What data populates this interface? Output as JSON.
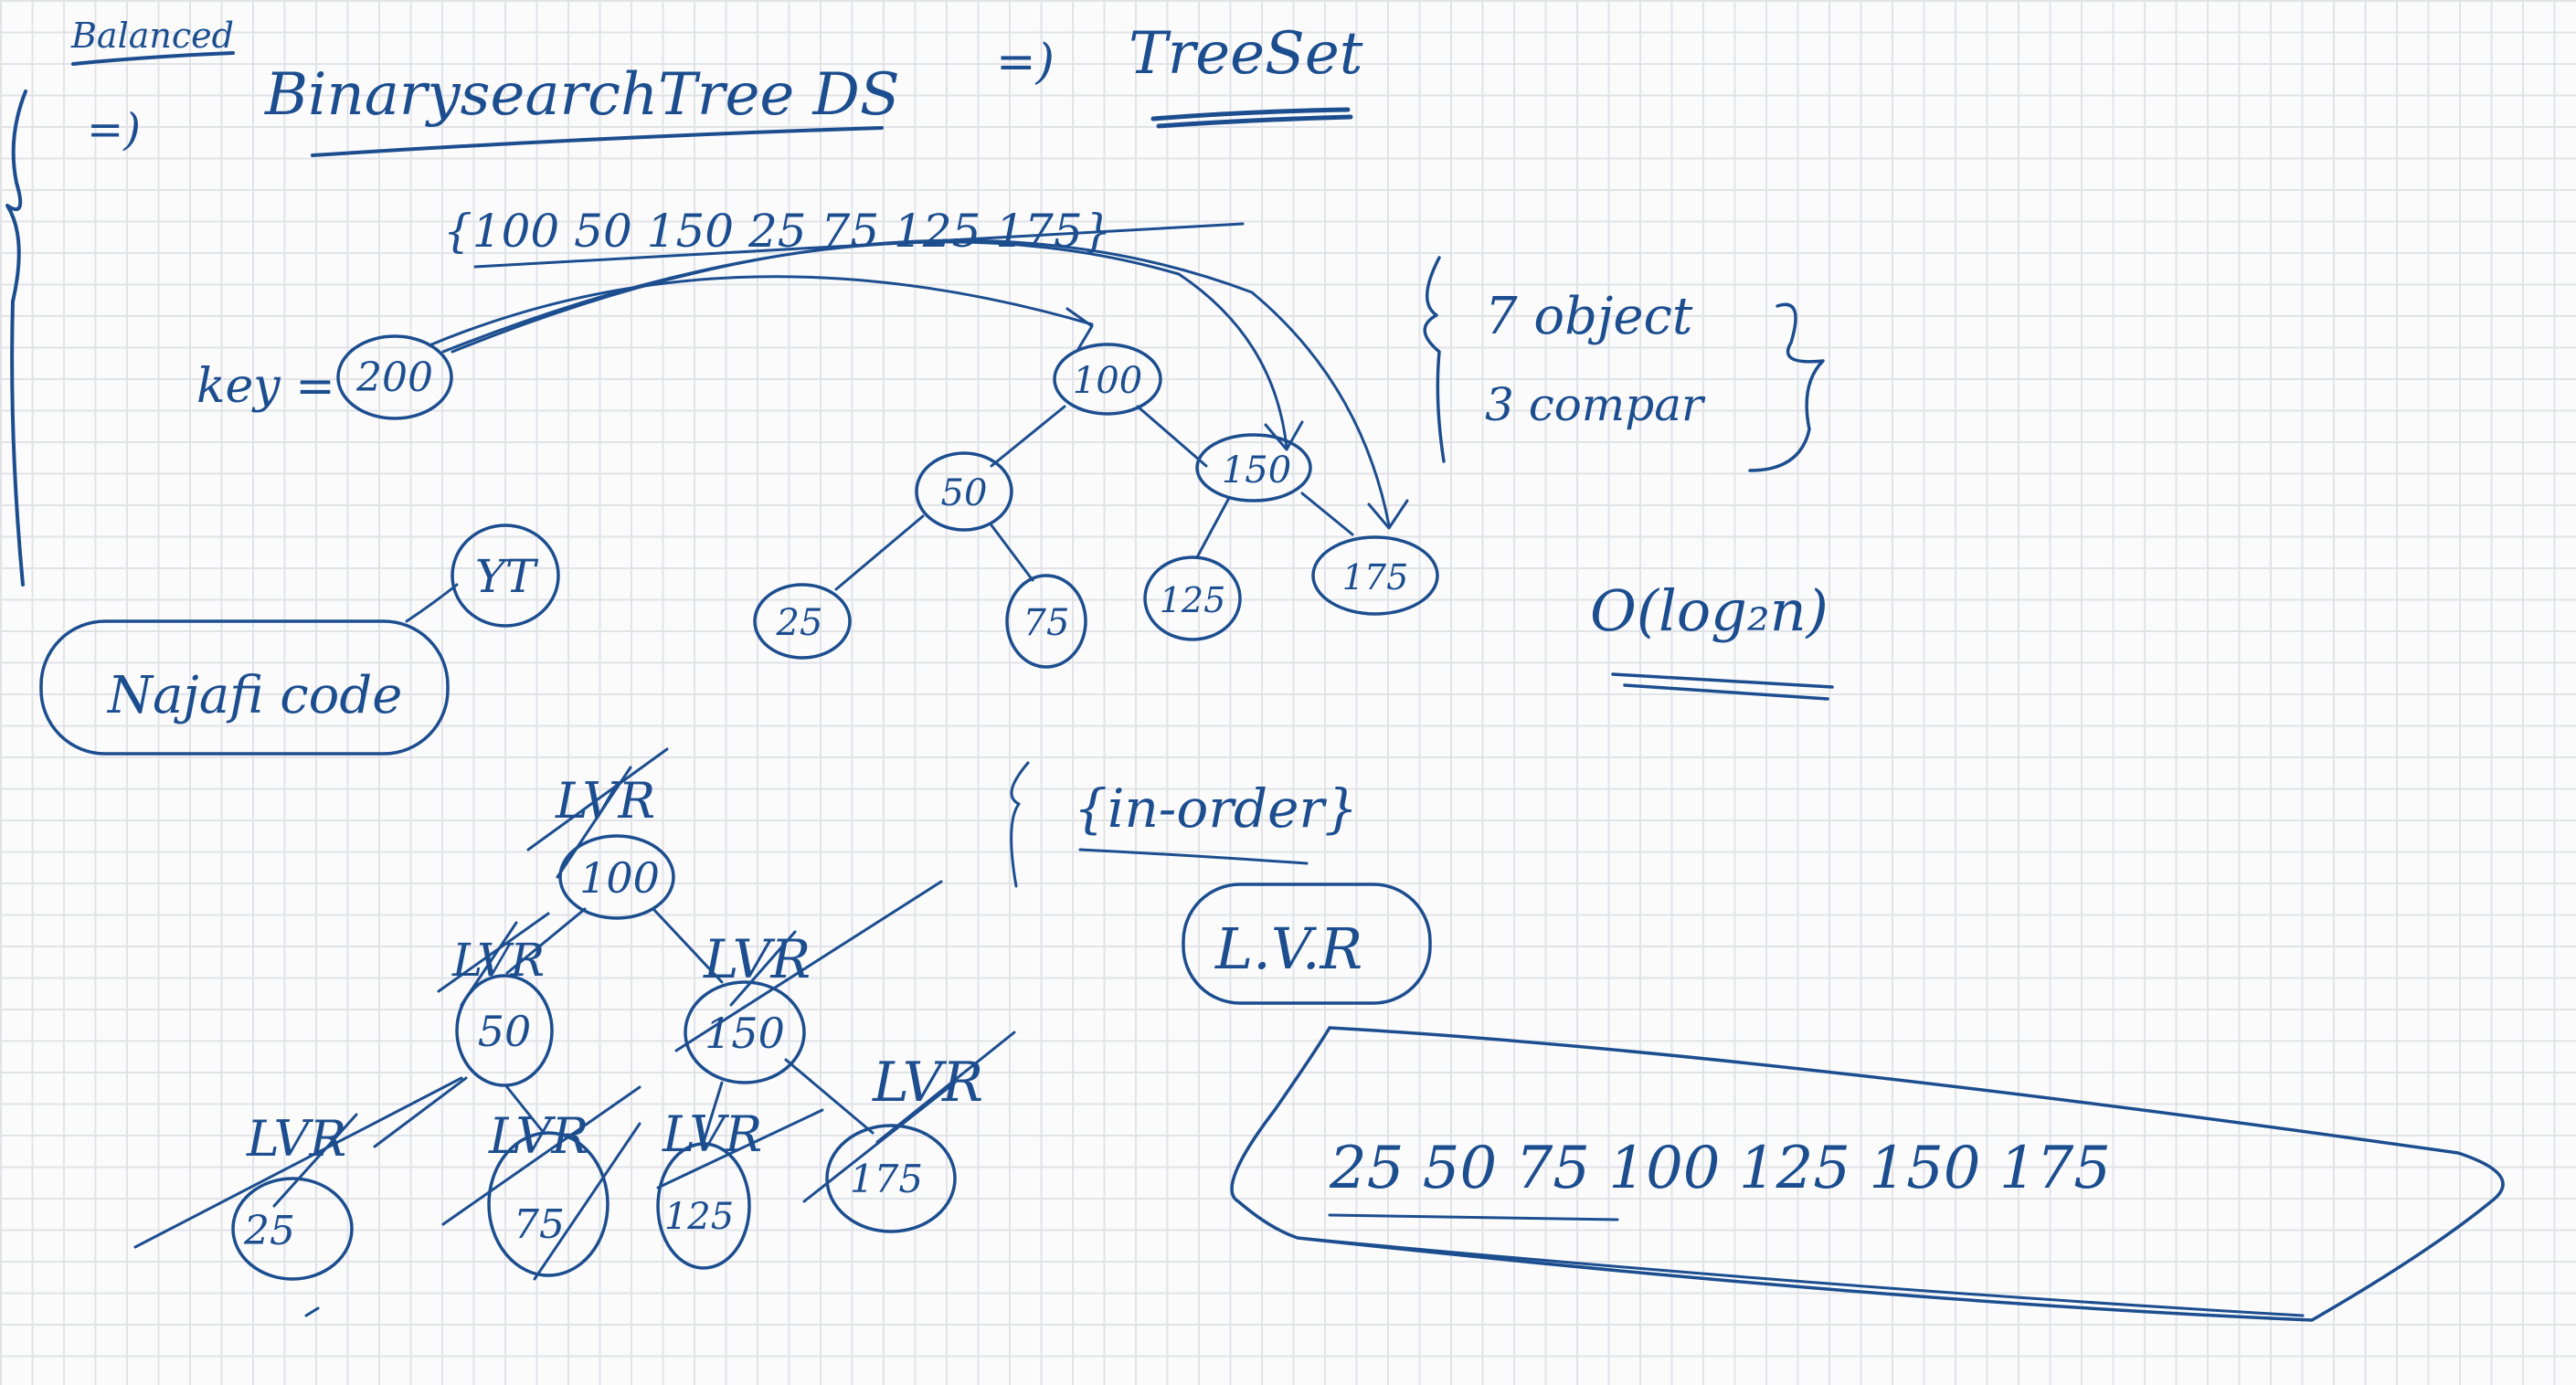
{
  "ink_color": "#1c4e8f",
  "notes": {
    "balanced": "Balanced",
    "arrow_left": "=)",
    "bst": "BinarysearchTree DS",
    "arrow_mid": "=)",
    "treeset": "TreeSet",
    "sequence": "{100 50 150 25 75 125 175}",
    "key_label": "key =",
    "key_value": "200",
    "objects_line1": "7 object",
    "objects_line2": "3 compar",
    "complexity": "O(log₂n)",
    "code_label": "Najafi code",
    "code_tag": "YT",
    "inorder": "{in-order}",
    "lvr": "L.V.R",
    "lvr_mark": "LVR",
    "result": "25 50 75 100 125 150 175"
  },
  "tree_top": {
    "root": "100",
    "left": "50",
    "right": "150",
    "ll": "25",
    "lr": "75",
    "rl": "125",
    "rr": "175"
  },
  "tree_bottom": {
    "root": "100",
    "left": "50",
    "right": "150",
    "ll": "25",
    "lr": "75",
    "rl": "125",
    "rr": "175"
  }
}
